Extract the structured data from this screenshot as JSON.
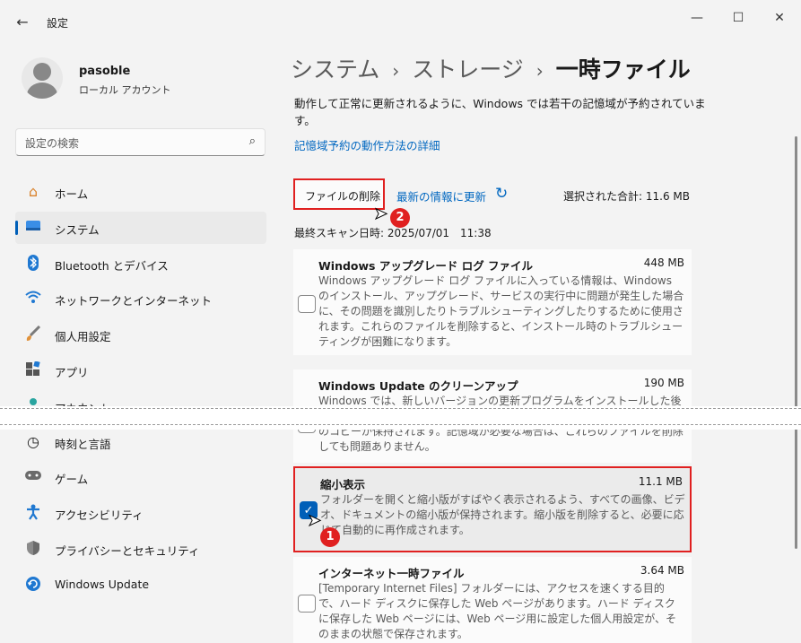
{
  "window": {
    "title": "設定",
    "back_icon": "back-arrow-icon",
    "minimize": "—",
    "maximize": "☐",
    "close": "✕"
  },
  "profile": {
    "name": "pasoble",
    "type": "ローカル アカウント"
  },
  "search": {
    "placeholder": "設定の検索"
  },
  "nav": {
    "items": [
      {
        "label": "ホーム",
        "icon": "home-icon"
      },
      {
        "label": "システム",
        "icon": "system-icon"
      },
      {
        "label": "Bluetooth とデバイス",
        "icon": "bluetooth-icon"
      },
      {
        "label": "ネットワークとインターネット",
        "icon": "wifi-icon"
      },
      {
        "label": "個人用設定",
        "icon": "brush-icon"
      },
      {
        "label": "アプリ",
        "icon": "apps-icon"
      },
      {
        "label": "アカウント",
        "icon": "account-icon"
      },
      {
        "label": "時刻と言語",
        "icon": "time-icon"
      },
      {
        "label": "ゲーム",
        "icon": "gamepad-icon"
      },
      {
        "label": "アクセシビリティ",
        "icon": "accessibility-icon"
      },
      {
        "label": "プライバシーとセキュリティ",
        "icon": "shield-icon"
      },
      {
        "label": "Windows Update",
        "icon": "update-icon"
      }
    ]
  },
  "breadcrumb": {
    "level1": "システム",
    "level2": "ストレージ",
    "current": "一時ファイル",
    "separator": "›"
  },
  "main": {
    "description": "動作して正常に更新されるように、Windows では若干の記憶域が予約されています。",
    "learn_link": "記憶域予約の動作方法の詳細",
    "delete_button": "ファイルの削除",
    "refresh_link": "最新の情報に更新",
    "total": "選択された合計: 11.6 MB",
    "last_scan": "最終スキャン日時: 2025/07/01　11:38"
  },
  "cards": [
    {
      "title": "Windows アップグレード ログ ファイル",
      "size": "448 MB",
      "checked": false,
      "description": "Windows アップグレード ログ ファイルに入っている情報は、Windows のインストール、アップグレード、サービスの実行中に問題が発生した場合に、その問題を識別したりトラブルシューティングしたりするために使用されます。これらのファイルを削除すると、インストール時のトラブルシューティングが困難になります。"
    },
    {
      "title": "Windows Update のクリーンアップ",
      "size": "190 MB",
      "checked": false,
      "description": "Windows では、新しいバージョンの更新プログラムをインストールした後でも、Windows Update からインストールされたすべての更新プログラムのコピーが保持されます。記憶域が必要な場合は、これらのファイルを削除しても問題ありません。"
    },
    {
      "title": "縮小表示",
      "size": "11.1 MB",
      "checked": true,
      "description": "フォルダーを開くと縮小版がすばやく表示されるよう、すべての画像、ビデオ、ドキュメントの縮小版が保持されます。縮小版を削除すると、必要に応じて自動的に再作成されます。"
    },
    {
      "title": "インターネット一時ファイル",
      "size": "3.64 MB",
      "checked": false,
      "description": "[Temporary Internet Files] フォルダーには、アクセスを速くする目的で、ハード ディスクに保存した Web ページがあります。ハード ディスクに保存した Web ページには、Web ページ用に設定した個人用設定が、そのままの状態で保存されます。"
    }
  ],
  "annotations": {
    "badge1": "1",
    "badge2": "2",
    "highlight_color": "#e02020"
  },
  "colors": {
    "accent": "#005fb8",
    "link": "#0067c0"
  }
}
